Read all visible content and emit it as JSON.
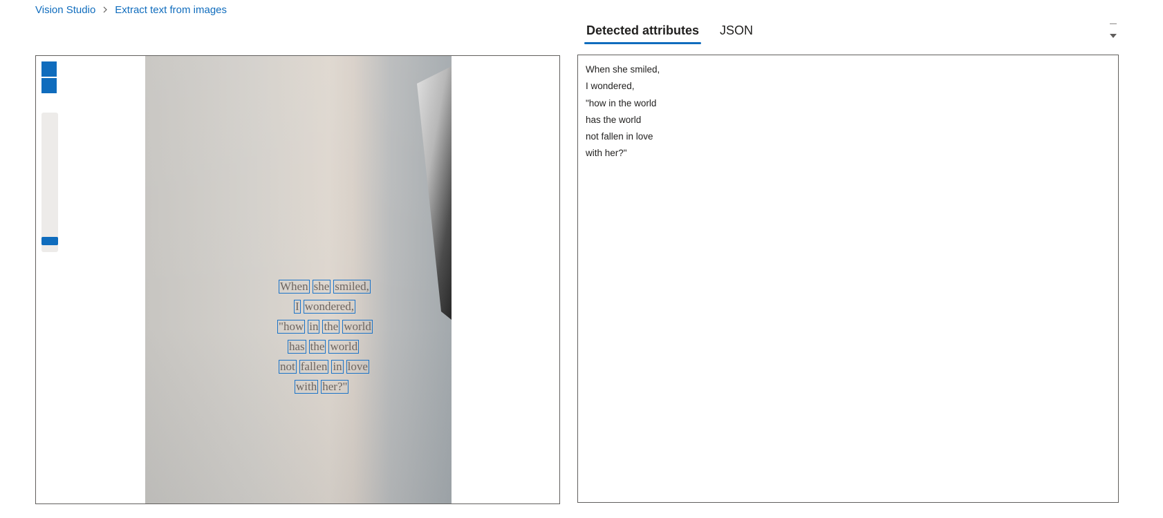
{
  "breadcrumb": {
    "root": "Vision Studio",
    "current": "Extract text from images"
  },
  "tabs": [
    {
      "label": "Detected attributes",
      "active": true
    },
    {
      "label": "JSON",
      "active": false
    }
  ],
  "viewer": {
    "zoom_in_label": "+",
    "zoom_out_label": "−",
    "ocr_lines": [
      {
        "words": [
          "When",
          "she",
          "smiled,"
        ]
      },
      {
        "words": [
          "I",
          "wondered,"
        ]
      },
      {
        "words": [
          "\"how",
          "in",
          "the",
          "world"
        ]
      },
      {
        "words": [
          "has",
          "the",
          "world"
        ]
      },
      {
        "words": [
          "not",
          "fallen",
          "in",
          "love"
        ]
      },
      {
        "words": [
          "with",
          "her?\""
        ]
      }
    ]
  },
  "results": {
    "lines": [
      "When she smiled,",
      "I wondered,",
      "\"how in the world",
      "has the world",
      "not fallen in love",
      "with her?\""
    ]
  },
  "colors": {
    "accent": "#0f6cbd",
    "box": "#1a73c8",
    "border": "#605e5c"
  }
}
